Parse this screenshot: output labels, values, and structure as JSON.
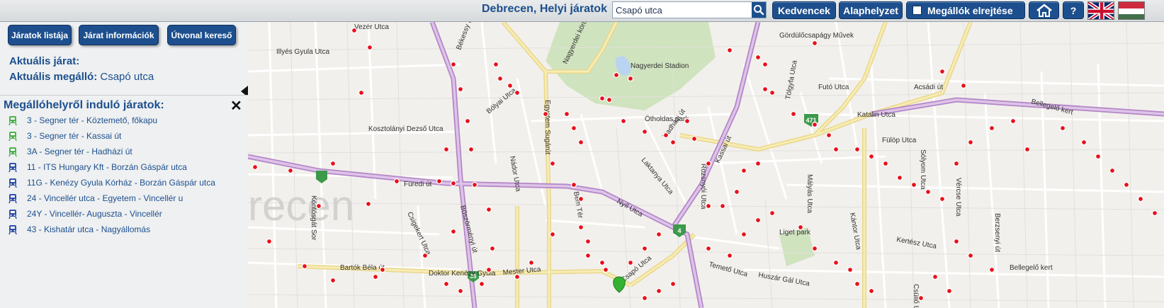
{
  "header": {
    "title": "Debrecen, Helyi járatok",
    "search_value": "Csapó utca",
    "buttons": {
      "favorites": "Kedvencek",
      "reset": "Alaphelyzet",
      "hide_stops": "Megállók elrejtése",
      "help": "?"
    },
    "icons": {
      "search": "search-icon",
      "home": "home-icon",
      "checkbox": "checkbox-icon"
    }
  },
  "panel": {
    "buttons": {
      "route_list": "Járatok listája",
      "route_info": "Járat információk",
      "route_planner": "Útvonal kereső"
    },
    "current_route_label": "Aktuális járat:",
    "current_route_value": "",
    "current_stop_label": "Aktuális megálló:",
    "current_stop_value": "Csapó utca",
    "routes_title": "Megállóhelyről induló járatok:",
    "routes": [
      {
        "text": "3 - Segner tér - Köztemető, főkapu",
        "type": "tram"
      },
      {
        "text": "3 - Segner tér - Kassai út",
        "type": "tram"
      },
      {
        "text": "3A - Segner tér - Hadházi út",
        "type": "tram"
      },
      {
        "text": "11 - ITS Hungary Kft - Borzán Gáspár utca",
        "type": "bus"
      },
      {
        "text": "11G - Kenézy Gyula Kórház - Borzán Gáspár utca",
        "type": "bus"
      },
      {
        "text": "24 - Vincellér utca - Egyetem - Vincellér u",
        "type": "bus"
      },
      {
        "text": "24Y - Vincellér- Auguszta - Vincellér",
        "type": "bus"
      },
      {
        "text": "43 - Kishatár utca - Nagyállomás",
        "type": "bus"
      }
    ]
  },
  "map": {
    "city_watermark": "recen",
    "labels": [
      {
        "text": "Vezér Utca"
      },
      {
        "text": "Illyés Gyula Utca"
      },
      {
        "text": "Békessy Béla Utca"
      },
      {
        "text": "Nagyerdei körút"
      },
      {
        "text": "Nagyerdei Stadion"
      },
      {
        "text": "Gördülőcsapágy Művek"
      },
      {
        "text": "Egyetem Sugárút"
      },
      {
        "text": "Bólyai Utca"
      },
      {
        "text": "Ötholdas park"
      },
      {
        "text": "Kosztolányi Dezső Utca"
      },
      {
        "text": "Hadházi út"
      },
      {
        "text": "Futó Utca"
      },
      {
        "text": "Acsádi út"
      },
      {
        "text": "Katalin Utca"
      },
      {
        "text": "Bellegelő kert"
      },
      {
        "text": "Füredi út"
      },
      {
        "text": "Böszörményi út"
      },
      {
        "text": "Nádor Utca"
      },
      {
        "text": "Laktanya Utca"
      },
      {
        "text": "Kassai út"
      },
      {
        "text": "Fülöp Utca"
      },
      {
        "text": "Sólyom Utca"
      },
      {
        "text": "Vércse Utca"
      },
      {
        "text": "Berzsenyi út"
      },
      {
        "text": "Nyíl Utca"
      },
      {
        "text": "Bem Tér"
      },
      {
        "text": "Kántor Utca"
      },
      {
        "text": "Köntösgát Sor"
      },
      {
        "text": "Csigekert Utca"
      },
      {
        "text": "Liget park"
      },
      {
        "text": "Bartók Béla út"
      },
      {
        "text": "Mester Utca"
      },
      {
        "text": "Csapó Utca"
      },
      {
        "text": "Temető Utca"
      },
      {
        "text": "Huszár Gál Utca"
      },
      {
        "text": "Doktor Kenézy Gyula"
      },
      {
        "text": "Bellegelő kert"
      },
      {
        "text": "Kertész Utca"
      },
      {
        "text": "Csüllő Utca"
      },
      {
        "text": "Rozsnyói Utca"
      },
      {
        "text": "Mályás Utca"
      },
      {
        "text": "Tölgyfa Utca"
      }
    ],
    "road_shields": [
      "471",
      "4",
      "35"
    ],
    "colors": {
      "primary": "#c7a0d8",
      "secondary": "#f7e8a0",
      "stop": "#e8101a",
      "marker": "#35b233"
    }
  }
}
